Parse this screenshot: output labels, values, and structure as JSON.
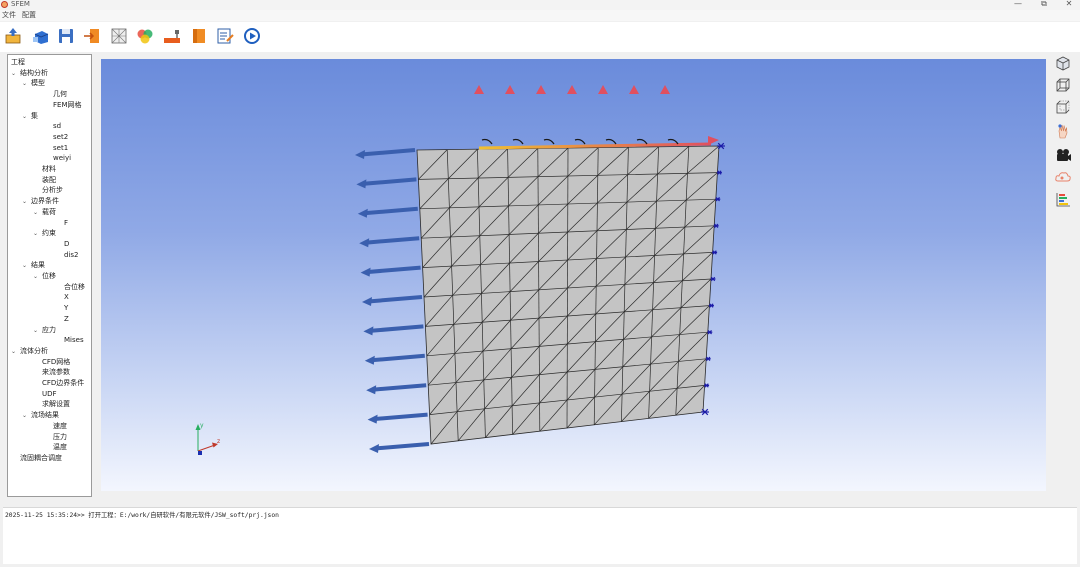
{
  "window": {
    "title": "SFEM",
    "minimize": "—",
    "restore": "⧉",
    "close": "✕"
  },
  "menu": [
    "文件",
    "配置"
  ],
  "toolbar_icons": [
    "import-model-icon",
    "open-geometry-icon",
    "save-icon",
    "export-icon",
    "mesh-icon",
    "materials-icon",
    "tools-icon",
    "sheet-icon",
    "edit-list-icon",
    "run-icon"
  ],
  "tree": {
    "root": "工程",
    "items": [
      {
        "label": "结构分析",
        "depth": 0,
        "expanded": true
      },
      {
        "label": "模型",
        "depth": 1,
        "expanded": true
      },
      {
        "label": "几何",
        "depth": 3
      },
      {
        "label": "FEM网格",
        "depth": 3
      },
      {
        "label": "集",
        "depth": 1,
        "expanded": true
      },
      {
        "label": "sd",
        "depth": 3
      },
      {
        "label": "set2",
        "depth": 3
      },
      {
        "label": "set1",
        "depth": 3
      },
      {
        "label": "weiyi",
        "depth": 3
      },
      {
        "label": "材料",
        "depth": 2
      },
      {
        "label": "装配",
        "depth": 2
      },
      {
        "label": "分析步",
        "depth": 2
      },
      {
        "label": "边界条件",
        "depth": 1,
        "expanded": true
      },
      {
        "label": "载荷",
        "depth": 2,
        "expanded": true
      },
      {
        "label": "F",
        "depth": 4
      },
      {
        "label": "约束",
        "depth": 2,
        "expanded": true
      },
      {
        "label": "D",
        "depth": 4
      },
      {
        "label": "dis2",
        "depth": 4
      },
      {
        "label": "结果",
        "depth": 1,
        "expanded": true
      },
      {
        "label": "位移",
        "depth": 2,
        "expanded": true
      },
      {
        "label": "合位移",
        "depth": 4
      },
      {
        "label": "X",
        "depth": 4
      },
      {
        "label": "Y",
        "depth": 4
      },
      {
        "label": "Z",
        "depth": 4
      },
      {
        "label": "应力",
        "depth": 2,
        "expanded": true
      },
      {
        "label": "Mises",
        "depth": 4
      },
      {
        "label": "流体分析",
        "depth": 0,
        "expanded": true
      },
      {
        "label": "CFD网格",
        "depth": 2
      },
      {
        "label": "来流参数",
        "depth": 2
      },
      {
        "label": "CFD边界条件",
        "depth": 2
      },
      {
        "label": "UDF",
        "depth": 2
      },
      {
        "label": "求解设置",
        "depth": 2
      },
      {
        "label": "流场结果",
        "depth": 1,
        "expanded": true
      },
      {
        "label": "速度",
        "depth": 3
      },
      {
        "label": "压力",
        "depth": 3
      },
      {
        "label": "温度",
        "depth": 3
      },
      {
        "label": "流固耦合调度",
        "depth": 0
      }
    ]
  },
  "viewport": {
    "background_top": "#6a8bdb",
    "background_bottom": "#f3f6fe",
    "mesh_fill": "#c4c4c4",
    "mesh_line": "#2a2a2a",
    "load_arrow_color": "#3a5fae",
    "constraint_color": "#1c1ca8",
    "mesh_divisions": 10,
    "triad": {
      "x": "z",
      "y": "y"
    }
  },
  "right_toolbar_icons": [
    "view-cube-solid-icon",
    "view-cube-wire-icon",
    "view-cube-hidden-icon",
    "pan-hand-icon",
    "camera-icon",
    "cloud-icon",
    "legend-icon"
  ],
  "console": {
    "line": "2025-11-25 15:35:24>> 打开工程：E:/work/自研软件/有限元软件/JSW_soft/prj.json"
  }
}
